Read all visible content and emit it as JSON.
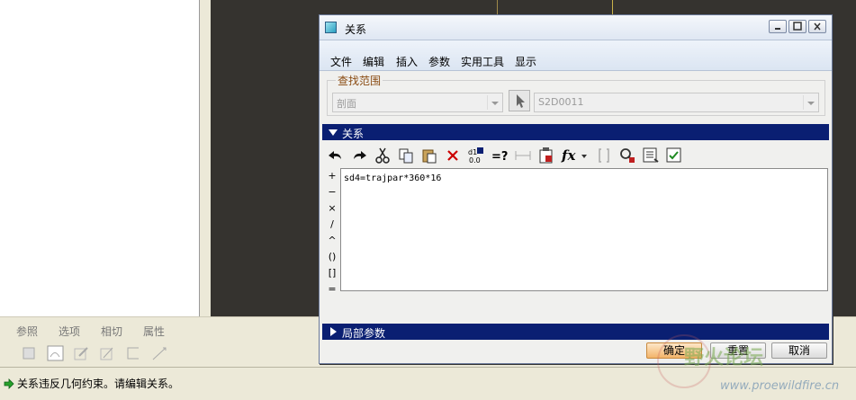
{
  "background": {
    "tabs": [
      "参照",
      "选项",
      "相切",
      "属性"
    ]
  },
  "status": {
    "message": "关系违反几何约束。请编辑关系。"
  },
  "dialog": {
    "title": "关系",
    "menu": [
      "文件",
      "编辑",
      "插入",
      "参数",
      "实用工具",
      "显示"
    ],
    "scope": {
      "label": "查找范围",
      "type_value": "剖面",
      "object_value": "S2D0011"
    },
    "relations_header": "关系",
    "operators": [
      "+",
      "−",
      "×",
      "/",
      "^",
      "()",
      "[]",
      "="
    ],
    "relation_text": "sd4=trajpar*360*16",
    "local_params_header": "局部参数",
    "buttons": {
      "ok": "确定",
      "reset": "重置",
      "cancel": "取消"
    }
  },
  "watermark": {
    "text": "野火论坛",
    "url": "www.proewildfire.cn"
  }
}
